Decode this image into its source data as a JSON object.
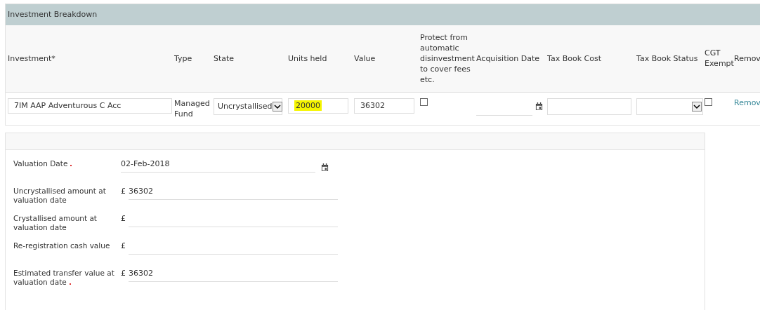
{
  "breakdown": {
    "title": "Investment Breakdown",
    "columns": [
      "Investment*",
      "Type",
      "State",
      "Units held",
      "Value",
      "Protect from automatic disinvestment to cover fees etc.",
      "Acquisition Date",
      "Tax Book Cost",
      "Tax Book Status",
      "CGT Exempt",
      "Remov"
    ],
    "rows": [
      {
        "investment": "7IM AAP Adventurous C Acc",
        "type": "Managed Fund",
        "state": "Uncrystallised",
        "units_held": "20000",
        "units_highlighted": true,
        "value": "36302",
        "protect": false,
        "cgt_exempt": false,
        "remove": "Remov"
      }
    ]
  },
  "valuation": {
    "fields": [
      {
        "kind": "date",
        "label": "Valuation Date",
        "required": true,
        "value": "02-Feb-2018"
      },
      {
        "kind": "amount",
        "label": "Uncrystallised amount at valuation date",
        "required": false,
        "currency": "£",
        "value": "36302"
      },
      {
        "kind": "amount",
        "label": "Crystallised amount at valuation date",
        "required": false,
        "currency": "£"
      },
      {
        "kind": "amount",
        "label": "Re-registration cash value",
        "required": false,
        "currency": "£"
      },
      {
        "kind": "amount",
        "label": "Estimated transfer value at valuation date",
        "required": true,
        "currency": "£",
        "value": "36302"
      }
    ]
  }
}
